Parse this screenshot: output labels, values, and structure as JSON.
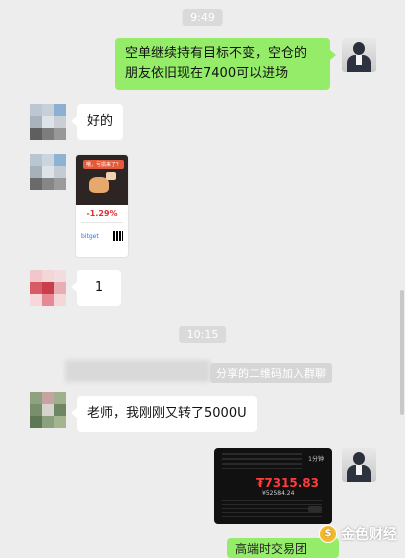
{
  "timestamps": [
    "9:49",
    "10:15"
  ],
  "messages": {
    "msg1": "空单继续持有目标不变，空仓的\n朋友依旧现在7400可以进场",
    "msg2": "好的",
    "msg4": "1",
    "msg5": "老师，我刚刚又转了5000U",
    "bottom": "高端时交易团"
  },
  "image_card": {
    "tag": "亏损",
    "top_text": "哦，亏损来了？",
    "value": "-1.29%",
    "footer": "bitget"
  },
  "system_notice": "分享的二维码加入群聊",
  "trading_screenshot": {
    "price": "₮7315.83",
    "sub_price": "¥52584.24",
    "tag": "1分钟"
  },
  "watermark": "金色财经",
  "colors": {
    "green_bubble": "#95ec69",
    "background": "#ededed",
    "red": "#ff3b3b"
  }
}
